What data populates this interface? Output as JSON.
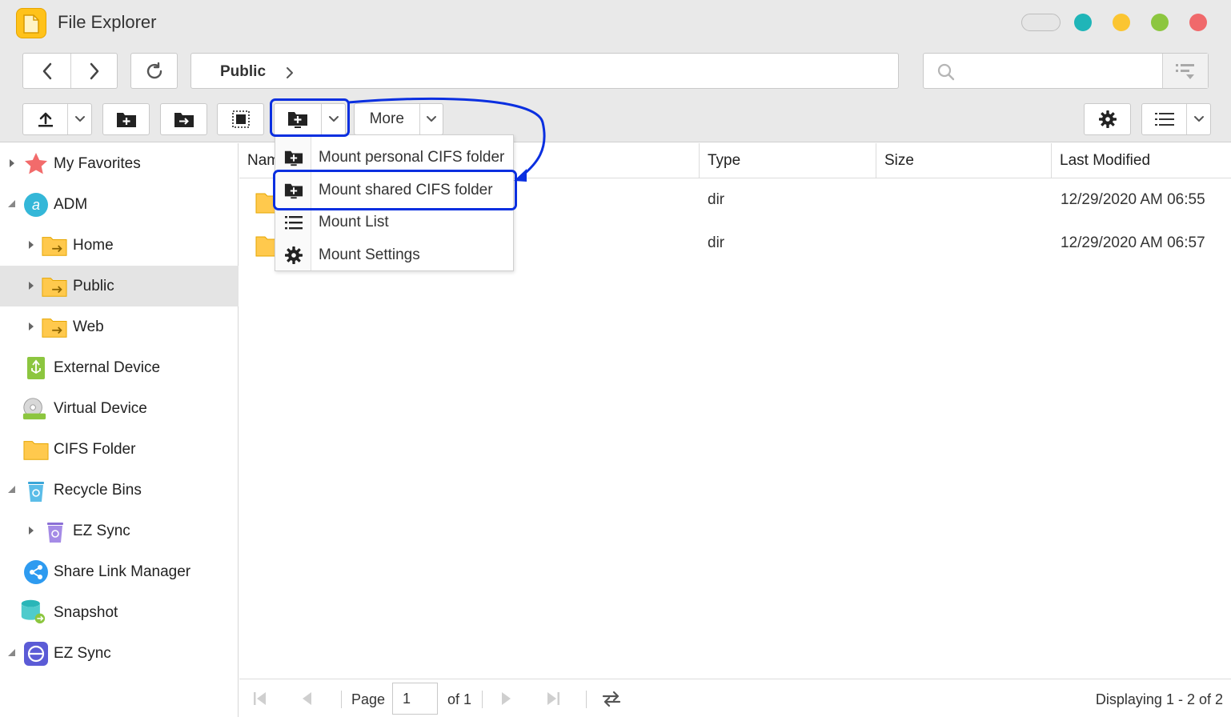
{
  "window": {
    "title": "File Explorer",
    "controls": {
      "toggle_color": "#e6e6e6",
      "teal": "#1fb5b8",
      "yellow": "#fbc531",
      "green": "#8cc63f",
      "red": "#f0696b"
    }
  },
  "nav": {
    "breadcrumb": [
      "Public"
    ]
  },
  "search": {
    "value": "",
    "placeholder": ""
  },
  "toolbar": {
    "more_label": "More",
    "icons": [
      "upload-icon",
      "new-folder-icon",
      "move-folder-icon",
      "select-all-icon",
      "mount-folder-icon",
      "gear-icon",
      "list-view-icon"
    ]
  },
  "mount_menu": {
    "items": [
      {
        "label": "Mount personal CIFS folder",
        "icon": "mount-folder-icon"
      },
      {
        "label": "Mount shared CIFS folder",
        "icon": "mount-folder-icon",
        "highlighted": true
      },
      {
        "label": "Mount List",
        "icon": "list-icon"
      },
      {
        "label": "Mount Settings",
        "icon": "gear-icon"
      }
    ]
  },
  "sidebar": {
    "items": [
      {
        "label": "My Favorites",
        "icon": "star-icon"
      },
      {
        "label": "ADM",
        "icon": "adm-icon"
      },
      {
        "label": "Home",
        "icon": "shared-folder-icon"
      },
      {
        "label": "Public",
        "icon": "shared-folder-icon",
        "selected": true
      },
      {
        "label": "Web",
        "icon": "shared-folder-icon"
      },
      {
        "label": "External Device",
        "icon": "usb-icon"
      },
      {
        "label": "Virtual Device",
        "icon": "disc-icon"
      },
      {
        "label": "CIFS Folder",
        "icon": "folder-icon"
      },
      {
        "label": "Recycle Bins",
        "icon": "recycle-bin-icon"
      },
      {
        "label": "EZ Sync",
        "icon": "recycle-bin-icon"
      },
      {
        "label": "Share Link Manager",
        "icon": "share-icon"
      },
      {
        "label": "Snapshot",
        "icon": "snapshot-icon"
      },
      {
        "label": "EZ Sync",
        "icon": "ez-sync-icon"
      }
    ]
  },
  "file_list": {
    "columns": [
      "Nam",
      "Type",
      "Size",
      "Last Modified"
    ],
    "rows": [
      {
        "name": "",
        "type": "dir",
        "size": "",
        "modified": "12/29/2020 AM 06:55"
      },
      {
        "name": "",
        "type": "dir",
        "size": "",
        "modified": "12/29/2020 AM 06:57"
      }
    ]
  },
  "pager": {
    "page_label": "Page",
    "page_value": "1",
    "of_label": "of 1",
    "display_text": "Displaying 1 - 2 of 2"
  },
  "colors": {
    "annotation_blue": "#0a2fe0",
    "folder_yellow": "#ffc94d",
    "selection_grey": "#e4e4e4"
  }
}
